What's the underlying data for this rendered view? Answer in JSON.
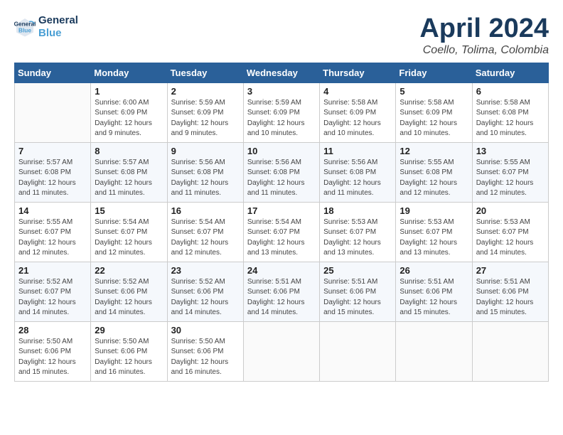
{
  "logo": {
    "line1": "General",
    "line2": "Blue"
  },
  "title": "April 2024",
  "subtitle": "Coello, Tolima, Colombia",
  "header_days": [
    "Sunday",
    "Monday",
    "Tuesday",
    "Wednesday",
    "Thursday",
    "Friday",
    "Saturday"
  ],
  "weeks": [
    [
      {
        "day": "",
        "info": ""
      },
      {
        "day": "1",
        "info": "Sunrise: 6:00 AM\nSunset: 6:09 PM\nDaylight: 12 hours\nand 9 minutes."
      },
      {
        "day": "2",
        "info": "Sunrise: 5:59 AM\nSunset: 6:09 PM\nDaylight: 12 hours\nand 9 minutes."
      },
      {
        "day": "3",
        "info": "Sunrise: 5:59 AM\nSunset: 6:09 PM\nDaylight: 12 hours\nand 10 minutes."
      },
      {
        "day": "4",
        "info": "Sunrise: 5:58 AM\nSunset: 6:09 PM\nDaylight: 12 hours\nand 10 minutes."
      },
      {
        "day": "5",
        "info": "Sunrise: 5:58 AM\nSunset: 6:09 PM\nDaylight: 12 hours\nand 10 minutes."
      },
      {
        "day": "6",
        "info": "Sunrise: 5:58 AM\nSunset: 6:08 PM\nDaylight: 12 hours\nand 10 minutes."
      }
    ],
    [
      {
        "day": "7",
        "info": "Sunrise: 5:57 AM\nSunset: 6:08 PM\nDaylight: 12 hours\nand 11 minutes."
      },
      {
        "day": "8",
        "info": "Sunrise: 5:57 AM\nSunset: 6:08 PM\nDaylight: 12 hours\nand 11 minutes."
      },
      {
        "day": "9",
        "info": "Sunrise: 5:56 AM\nSunset: 6:08 PM\nDaylight: 12 hours\nand 11 minutes."
      },
      {
        "day": "10",
        "info": "Sunrise: 5:56 AM\nSunset: 6:08 PM\nDaylight: 12 hours\nand 11 minutes."
      },
      {
        "day": "11",
        "info": "Sunrise: 5:56 AM\nSunset: 6:08 PM\nDaylight: 12 hours\nand 11 minutes."
      },
      {
        "day": "12",
        "info": "Sunrise: 5:55 AM\nSunset: 6:08 PM\nDaylight: 12 hours\nand 12 minutes."
      },
      {
        "day": "13",
        "info": "Sunrise: 5:55 AM\nSunset: 6:07 PM\nDaylight: 12 hours\nand 12 minutes."
      }
    ],
    [
      {
        "day": "14",
        "info": "Sunrise: 5:55 AM\nSunset: 6:07 PM\nDaylight: 12 hours\nand 12 minutes."
      },
      {
        "day": "15",
        "info": "Sunrise: 5:54 AM\nSunset: 6:07 PM\nDaylight: 12 hours\nand 12 minutes."
      },
      {
        "day": "16",
        "info": "Sunrise: 5:54 AM\nSunset: 6:07 PM\nDaylight: 12 hours\nand 12 minutes."
      },
      {
        "day": "17",
        "info": "Sunrise: 5:54 AM\nSunset: 6:07 PM\nDaylight: 12 hours\nand 13 minutes."
      },
      {
        "day": "18",
        "info": "Sunrise: 5:53 AM\nSunset: 6:07 PM\nDaylight: 12 hours\nand 13 minutes."
      },
      {
        "day": "19",
        "info": "Sunrise: 5:53 AM\nSunset: 6:07 PM\nDaylight: 12 hours\nand 13 minutes."
      },
      {
        "day": "20",
        "info": "Sunrise: 5:53 AM\nSunset: 6:07 PM\nDaylight: 12 hours\nand 14 minutes."
      }
    ],
    [
      {
        "day": "21",
        "info": "Sunrise: 5:52 AM\nSunset: 6:07 PM\nDaylight: 12 hours\nand 14 minutes."
      },
      {
        "day": "22",
        "info": "Sunrise: 5:52 AM\nSunset: 6:06 PM\nDaylight: 12 hours\nand 14 minutes."
      },
      {
        "day": "23",
        "info": "Sunrise: 5:52 AM\nSunset: 6:06 PM\nDaylight: 12 hours\nand 14 minutes."
      },
      {
        "day": "24",
        "info": "Sunrise: 5:51 AM\nSunset: 6:06 PM\nDaylight: 12 hours\nand 14 minutes."
      },
      {
        "day": "25",
        "info": "Sunrise: 5:51 AM\nSunset: 6:06 PM\nDaylight: 12 hours\nand 15 minutes."
      },
      {
        "day": "26",
        "info": "Sunrise: 5:51 AM\nSunset: 6:06 PM\nDaylight: 12 hours\nand 15 minutes."
      },
      {
        "day": "27",
        "info": "Sunrise: 5:51 AM\nSunset: 6:06 PM\nDaylight: 12 hours\nand 15 minutes."
      }
    ],
    [
      {
        "day": "28",
        "info": "Sunrise: 5:50 AM\nSunset: 6:06 PM\nDaylight: 12 hours\nand 15 minutes."
      },
      {
        "day": "29",
        "info": "Sunrise: 5:50 AM\nSunset: 6:06 PM\nDaylight: 12 hours\nand 16 minutes."
      },
      {
        "day": "30",
        "info": "Sunrise: 5:50 AM\nSunset: 6:06 PM\nDaylight: 12 hours\nand 16 minutes."
      },
      {
        "day": "",
        "info": ""
      },
      {
        "day": "",
        "info": ""
      },
      {
        "day": "",
        "info": ""
      },
      {
        "day": "",
        "info": ""
      }
    ]
  ]
}
